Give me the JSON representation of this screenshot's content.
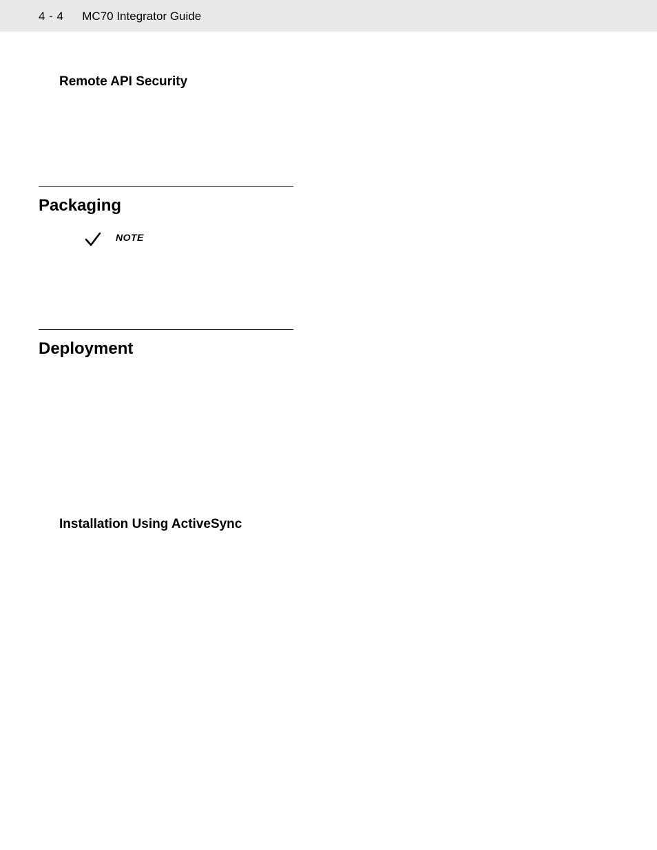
{
  "header": {
    "page_number": "4 - 4",
    "doc_title": "MC70 Integrator Guide"
  },
  "sections": {
    "remote_api": {
      "heading": "Remote API Security"
    },
    "packaging": {
      "heading": "Packaging",
      "note_label": "NOTE"
    },
    "deployment": {
      "heading": "Deployment"
    },
    "install_activesync": {
      "heading": "Installation Using ActiveSync"
    }
  }
}
